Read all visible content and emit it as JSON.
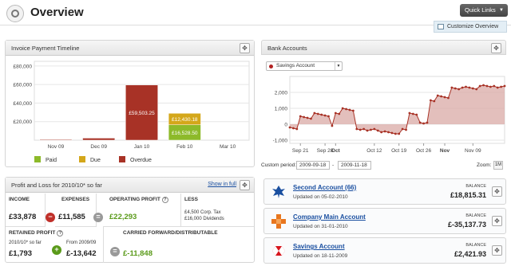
{
  "header": {
    "title": "Overview",
    "quick_links": "Quick Links",
    "customize": "Customize Overview"
  },
  "invoice_panel": {
    "title": "Invoice Payment Timeline",
    "legend": [
      {
        "label": "Paid",
        "color": "#8dba2a"
      },
      {
        "label": "Due",
        "color": "#d4a71a"
      },
      {
        "label": "Overdue",
        "color": "#a83226"
      }
    ]
  },
  "chart_data": [
    {
      "type": "bar",
      "title": "Invoice Payment Timeline",
      "categories": [
        "Nov 09",
        "Dec 09",
        "Jan 10",
        "Feb 10",
        "Mar 10"
      ],
      "yticks": [
        "£80,000",
        "£60,000",
        "£40,000",
        "£20,000"
      ],
      "ylim": [
        0,
        85000
      ],
      "series": [
        {
          "name": "Paid",
          "values": [
            0,
            0,
            0,
            16528.5,
            0
          ],
          "labels": [
            "",
            "",
            "",
            "£16,528.50",
            ""
          ]
        },
        {
          "name": "Due",
          "values": [
            0,
            0,
            0,
            12430.18,
            0
          ],
          "labels": [
            "",
            "",
            "",
            "£12,430.18",
            ""
          ]
        },
        {
          "name": "Overdue",
          "values": [
            800,
            2200,
            59503.25,
            0,
            0
          ],
          "labels": [
            "",
            "",
            "£59,503.25",
            "",
            ""
          ]
        }
      ],
      "colors": {
        "Paid": "#8dba2a",
        "Due": "#d4a71a",
        "Overdue": "#a83226"
      },
      "legend_position": "bottom",
      "grid": true
    },
    {
      "type": "area",
      "title": "Bank Accounts",
      "series_name": "Savings Account",
      "color": "#a83226",
      "xticks": [
        "Sep 21",
        "Sep 28",
        "Oct",
        "Oct 12",
        "Oct 19",
        "Oct 26",
        "Nov",
        "Nov 09"
      ],
      "yticks": [
        "2,000",
        "1,000",
        "0",
        "-1,000"
      ],
      "ylim": [
        -1200,
        3000
      ],
      "x": [
        "2009-09-18",
        "2009-09-19",
        "2009-09-20",
        "2009-09-21",
        "2009-09-22",
        "2009-09-23",
        "2009-09-24",
        "2009-09-25",
        "2009-09-26",
        "2009-09-27",
        "2009-09-28",
        "2009-09-29",
        "2009-09-30",
        "2009-10-01",
        "2009-10-02",
        "2009-10-03",
        "2009-10-04",
        "2009-10-05",
        "2009-10-06",
        "2009-10-07",
        "2009-10-08",
        "2009-10-09",
        "2009-10-10",
        "2009-10-11",
        "2009-10-12",
        "2009-10-13",
        "2009-10-14",
        "2009-10-15",
        "2009-10-16",
        "2009-10-17",
        "2009-10-18",
        "2009-10-19",
        "2009-10-20",
        "2009-10-21",
        "2009-10-22",
        "2009-10-23",
        "2009-10-24",
        "2009-10-25",
        "2009-10-26",
        "2009-10-27",
        "2009-10-28",
        "2009-10-29",
        "2009-10-30",
        "2009-10-31",
        "2009-11-01",
        "2009-11-02",
        "2009-11-03",
        "2009-11-04",
        "2009-11-05",
        "2009-11-06",
        "2009-11-07",
        "2009-11-08",
        "2009-11-09",
        "2009-11-10",
        "2009-11-11",
        "2009-11-12",
        "2009-11-13",
        "2009-11-14",
        "2009-11-15",
        "2009-11-16",
        "2009-11-17",
        "2009-11-18"
      ],
      "values": [
        -200,
        -250,
        -300,
        500,
        450,
        400,
        350,
        700,
        650,
        600,
        550,
        500,
        -100,
        700,
        650,
        1000,
        950,
        900,
        850,
        -300,
        -350,
        -300,
        -400,
        -350,
        -300,
        -400,
        -500,
        -450,
        -500,
        -550,
        -600,
        -600,
        -300,
        -350,
        700,
        650,
        600,
        100,
        50,
        100,
        1500,
        1450,
        1800,
        1750,
        1700,
        1650,
        2300,
        2250,
        2200,
        2300,
        2350,
        2300,
        2250,
        2200,
        2400,
        2450,
        2400,
        2350,
        2400,
        2300,
        2350,
        2400
      ],
      "date_range": {
        "label": "Custom period:",
        "from": "2009-09-18",
        "to": "2009-11-18"
      },
      "zoom": {
        "label": "Zoom:",
        "value": "1M"
      }
    }
  ],
  "pl_panel": {
    "title": "Profit and Loss for 2010/10* so far",
    "link": "Show in full",
    "income_label": "INCOME",
    "income_value": "£33,878",
    "expenses_label": "EXPENSES",
    "expenses_value": "£11,585",
    "op_profit_label": "OPERATING PROFIT",
    "op_profit_value": "£22,293",
    "less_label": "LESS",
    "less_line1": "£4,500 Corp. Tax",
    "less_line2": "£16,000 Dividends",
    "retained_label": "RETAINED PROFIT",
    "retained_sub": "2010/10* so far",
    "retained_value": "£1,793",
    "prev_sub": "From 2009/09",
    "prev_value": "£-13,642",
    "carried_label": "CARRIED FORWARD/DISTRIBUTABLE",
    "carried_value": "£-11,848",
    "help_glyph": "?"
  },
  "bank_panel": {
    "title": "Bank Accounts",
    "selected_account": "Savings Account"
  },
  "accounts": [
    {
      "name": "Second Account (66)",
      "updated": "Updated on 05-02-2010",
      "balance_label": "BALANCE",
      "balance": "£18,815.31",
      "logo_color": "#1a4fa0"
    },
    {
      "name": "Company Main Account",
      "updated": "Updated on 31-01-2010",
      "balance_label": "BALANCE",
      "balance": "£-35,137.73",
      "logo_color": "#e8761e"
    },
    {
      "name": "Savings Account",
      "updated": "Updated on 18-11-2009",
      "balance_label": "BALANCE",
      "balance": "£2,421.93",
      "logo_color": "#d7141c"
    }
  ]
}
